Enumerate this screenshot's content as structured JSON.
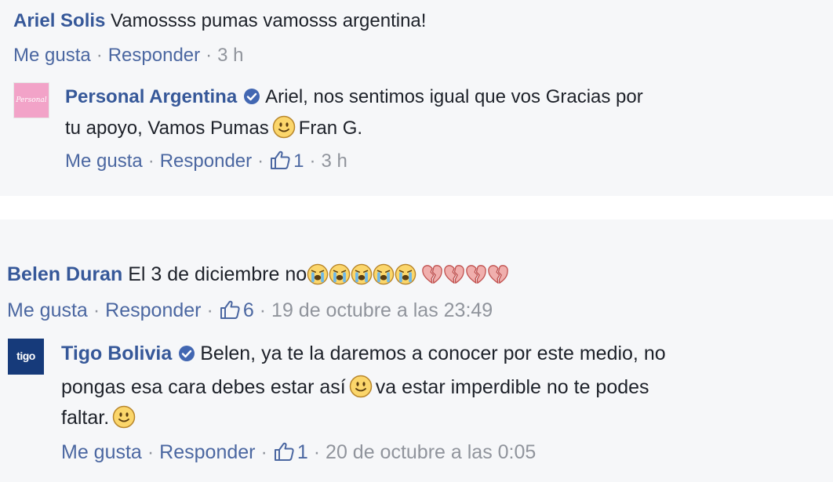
{
  "comments": [
    {
      "author": "Ariel Solis",
      "text": "Vamossss pumas vamosss argentina!",
      "actions": {
        "like": "Me gusta",
        "reply": "Responder",
        "time": "3 h"
      },
      "reply": {
        "author": "Personal Argentina",
        "avatar_text": "Personal",
        "verified": true,
        "text_line1": "Ariel, nos sentimos igual que vos Gracias por",
        "text_line2a": "tu apoyo, Vamos Pumas",
        "text_line2b": "Fran G.",
        "actions": {
          "like": "Me gusta",
          "reply": "Responder",
          "like_count": "1",
          "time": "3 h"
        }
      }
    },
    {
      "author": "Belen Duran",
      "text": "El 3 de diciembre no",
      "emoji_sequence": [
        "crying-face",
        "crying-face",
        "crying-face",
        "crying-face",
        "crying-face",
        "broken-heart",
        "broken-heart",
        "broken-heart",
        "broken-heart"
      ],
      "actions": {
        "like": "Me gusta",
        "reply": "Responder",
        "like_count": "6",
        "time": "19 de octubre a las 23:49"
      },
      "reply": {
        "author": "Tigo Bolivia",
        "avatar_text": "tigo",
        "verified": true,
        "text_line1": "Belen, ya te la daremos a conocer por este medio, no",
        "text_line2a": "pongas esa cara debes estar así",
        "text_line2b": "va estar imperdible no te podes",
        "text_line3": "faltar.",
        "actions": {
          "like": "Me gusta",
          "reply": "Responder",
          "like_count": "1",
          "time": "20 de octubre a las 0:05"
        }
      }
    }
  ],
  "colors": {
    "name": "#365899",
    "text": "#1d2129",
    "meta": "#7f7f7f",
    "link": "#4b67a1",
    "panel_bg": "#f6f7f9",
    "verified": "#4267b2"
  }
}
